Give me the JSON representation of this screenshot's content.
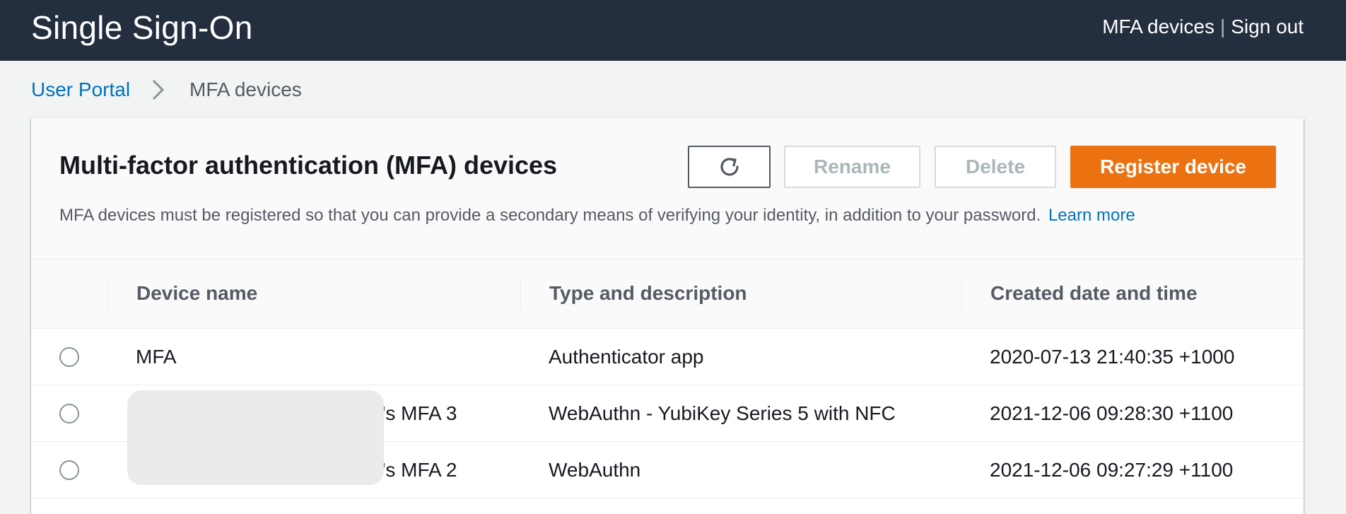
{
  "topbar": {
    "title": "Single Sign-On",
    "link_mfa": "MFA devices",
    "separator": "|",
    "link_signout": "Sign out"
  },
  "breadcrumb": {
    "home": "User Portal",
    "current": "MFA devices"
  },
  "panel": {
    "title": "Multi-factor authentication (MFA) devices",
    "description": "MFA devices must be registered so that you can provide a secondary means of verifying your identity, in addition to your password.",
    "learn_more": "Learn more",
    "buttons": {
      "refresh_icon": "refresh-icon",
      "rename": "Rename",
      "delete": "Delete",
      "register": "Register device"
    }
  },
  "table": {
    "columns": [
      "Device name",
      "Type and description",
      "Created date and time"
    ],
    "rows": [
      {
        "name": "MFA",
        "type": "Authenticator app",
        "created": "2020-07-13 21:40:35 +1000"
      },
      {
        "name": "'s MFA 3",
        "type": "WebAuthn - YubiKey Series 5 with NFC",
        "created": "2021-12-06 09:28:30 +1100"
      },
      {
        "name": "'s MFA 2",
        "type": "WebAuthn",
        "created": "2021-12-06 09:27:29 +1100"
      }
    ]
  },
  "colors": {
    "topbar_bg": "#232f3e",
    "link": "#0073bb",
    "primary": "#ec7211",
    "disabled_text": "#aab7b8"
  }
}
